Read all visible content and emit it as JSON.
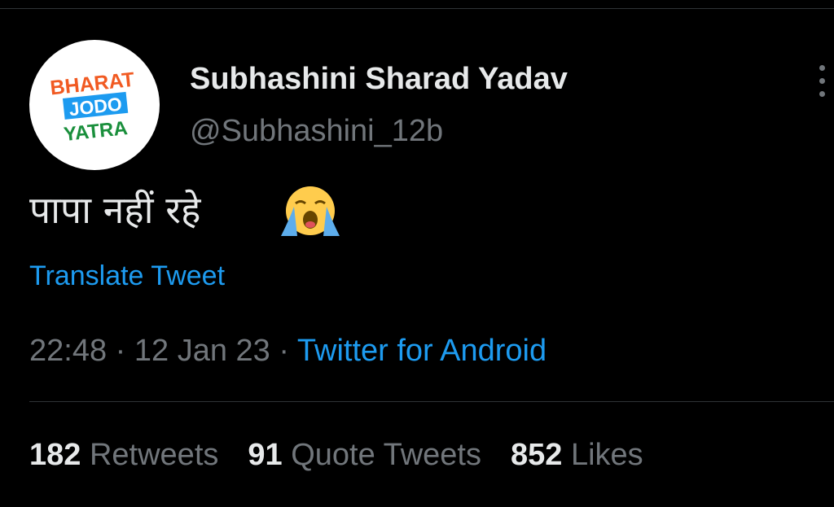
{
  "author": {
    "display_name": "Subhashini Sharad Yadav",
    "handle": "@Subhashini_12b",
    "avatar_logo": [
      "BHARAT",
      "JODO",
      "YATRA"
    ]
  },
  "tweet": {
    "text": "पापा नहीं रहे",
    "emoji": "loudly-crying-face"
  },
  "translate_label": "Translate Tweet",
  "meta": {
    "time": "22:48",
    "separator": "·",
    "date": "12 Jan 23",
    "source": "Twitter for Android"
  },
  "stats": {
    "retweets": {
      "count": "182",
      "label": "Retweets"
    },
    "quotes": {
      "count": "91",
      "label": "Quote Tweets"
    },
    "likes": {
      "count": "852",
      "label": "Likes"
    }
  },
  "colors": {
    "background": "#000000",
    "primary_text": "#e7e9ea",
    "secondary_text": "#71767b",
    "link": "#1d9bf0",
    "logo_orange": "#f15a22",
    "logo_blue": "#1d9bf0",
    "logo_green": "#1a8f3c"
  }
}
